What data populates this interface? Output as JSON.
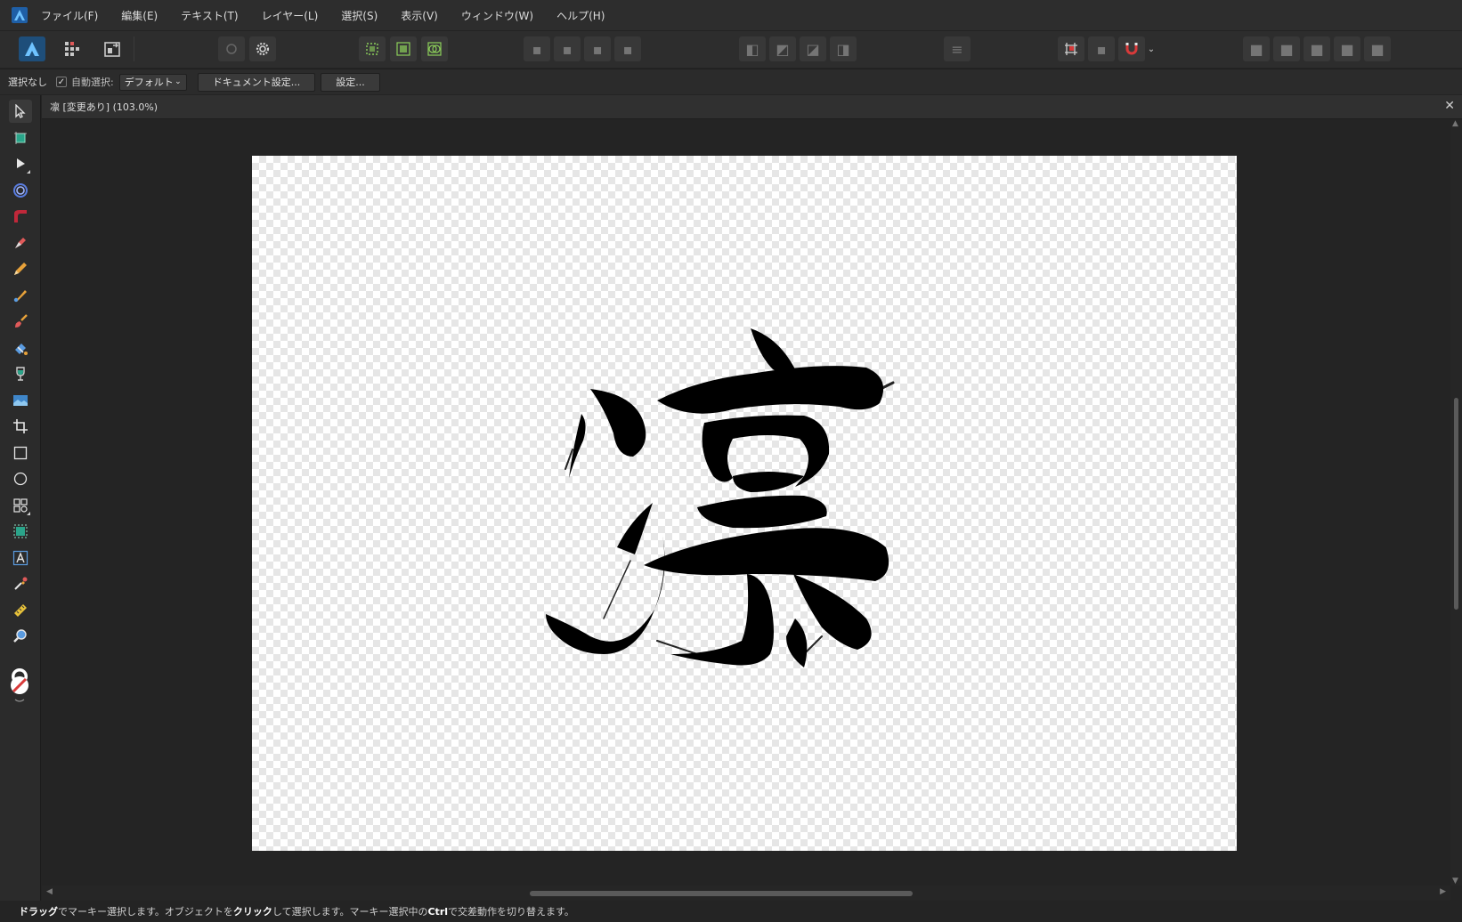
{
  "menu": {
    "items": [
      "ファイル(F)",
      "編集(E)",
      "テキスト(T)",
      "レイヤー(L)",
      "選択(S)",
      "表示(V)",
      "ウィンドウ(W)",
      "ヘルプ(H)"
    ]
  },
  "context": {
    "selection_label": "選択なし",
    "auto_select_checked": true,
    "auto_select_label": "自動選択:",
    "auto_select_value": "デフォルト",
    "doc_settings_button": "ドキュメント設定...",
    "settings_button": "設定..."
  },
  "document": {
    "tab_title": "凛 [変更あり] (103.0%)",
    "close_glyph": "✕"
  },
  "status": {
    "parts": [
      {
        "text": "ドラッグ",
        "bold": true
      },
      {
        "text": "でマーキー選択します。オブジェクトを",
        "bold": false
      },
      {
        "text": "クリック",
        "bold": true
      },
      {
        "text": "して選択します。マーキー選択中の",
        "bold": false
      },
      {
        "text": "Ctrl",
        "bold": true
      },
      {
        "text": "で交差動作を切り替えます。",
        "bold": false
      }
    ]
  },
  "tools": [
    {
      "name": "move-tool-icon",
      "selected": true
    },
    {
      "name": "artboard-tool-icon",
      "selected": false
    },
    {
      "name": "node-tool-icon",
      "selected": false
    },
    {
      "name": "contour-tool-icon",
      "selected": false
    },
    {
      "name": "corner-tool-icon",
      "selected": false
    },
    {
      "name": "pen-tool-icon",
      "selected": false
    },
    {
      "name": "pencil-tool-icon",
      "selected": false
    },
    {
      "name": "vector-brush-tool-icon",
      "selected": false
    },
    {
      "name": "paint-brush-tool-icon",
      "selected": false
    },
    {
      "name": "fill-tool-icon",
      "selected": false
    },
    {
      "name": "transparency-tool-icon",
      "selected": false
    },
    {
      "name": "place-image-tool-icon",
      "selected": false
    },
    {
      "name": "crop-tool-icon",
      "selected": false
    },
    {
      "name": "rectangle-tool-icon",
      "selected": false
    },
    {
      "name": "ellipse-tool-icon",
      "selected": false
    },
    {
      "name": "shapes-tool-icon",
      "selected": false
    },
    {
      "name": "transform-shape-tool-icon",
      "selected": false
    },
    {
      "name": "text-tool-icon",
      "selected": false
    },
    {
      "name": "color-picker-tool-icon",
      "selected": false
    },
    {
      "name": "measure-tool-icon",
      "selected": false
    },
    {
      "name": "zoom-tool-icon",
      "selected": false
    }
  ],
  "colors": {
    "accent": "#1e6fb8",
    "snapping_red": "#d93a3a",
    "canvas_bg": "#242424"
  }
}
